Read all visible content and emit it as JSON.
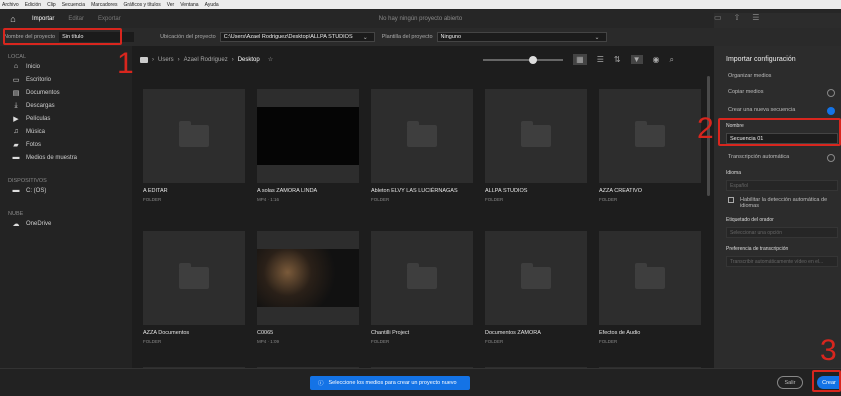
{
  "menu": [
    "Archivo",
    "Edición",
    "Clip",
    "Secuencia",
    "Marcadores",
    "Gráficos y títulos",
    "Ver",
    "Ventana",
    "Ayuda"
  ],
  "tabs": {
    "importar": "Importar",
    "editar": "Editar",
    "exportar": "Exportar"
  },
  "header_title": "No hay ningún proyecto abierto",
  "project": {
    "name_label": "Nombre del proyecto",
    "name_value": "Sin título",
    "location_label": "Ubicación del proyecto",
    "location_value": "C:\\Users\\Azael Rodriguez\\Desktop\\ALLPA STUDIOS",
    "template_label": "Plantilla del proyecto",
    "template_value": "Ninguno"
  },
  "sidebar": {
    "section1": "LOCAL",
    "local": [
      {
        "label": "Inicio",
        "icon": "home-icon"
      },
      {
        "label": "Escritorio",
        "icon": "desktop-icon"
      },
      {
        "label": "Documentos",
        "icon": "document-icon"
      },
      {
        "label": "Descargas",
        "icon": "download-icon"
      },
      {
        "label": "Películas",
        "icon": "film-icon"
      },
      {
        "label": "Música",
        "icon": "music-icon"
      },
      {
        "label": "Fotos",
        "icon": "photo-icon"
      },
      {
        "label": "Medios de muestra",
        "icon": "folder-icon"
      }
    ],
    "section2": "DISPOSITIVOS",
    "devices": [
      {
        "label": "C: (OS)",
        "icon": "drive-icon"
      }
    ],
    "section3": "NUBE",
    "cloud": [
      {
        "label": "OneDrive",
        "icon": "cloud-icon"
      }
    ]
  },
  "breadcrumb": {
    "users": "Users",
    "user": "Azael Rodriguez",
    "current": "Desktop"
  },
  "items": [
    {
      "name": "A EDITAR",
      "sub": "FOLDER",
      "type": "folder"
    },
    {
      "name": "A solas ZAMORA LINDA",
      "sub": "MP4 · 1:16",
      "type": "video-dark"
    },
    {
      "name": "Ableton ELVY LAS LUCIÉRNAGAS",
      "sub": "FOLDER",
      "type": "folder"
    },
    {
      "name": "ALLPA STUDIOS",
      "sub": "FOLDER",
      "type": "folder"
    },
    {
      "name": "AZZA CREATIVO",
      "sub": "FOLDER",
      "type": "folder"
    },
    {
      "name": "AZZA Documentos",
      "sub": "FOLDER",
      "type": "folder"
    },
    {
      "name": "C0065",
      "sub": "MP4 · 1:09",
      "type": "video-scene"
    },
    {
      "name": "Chantilli Project",
      "sub": "FOLDER",
      "type": "folder"
    },
    {
      "name": "Documentos ZAMORA",
      "sub": "FOLDER",
      "type": "folder"
    },
    {
      "name": "Efectos de Audio",
      "sub": "FOLDER",
      "type": "folder"
    }
  ],
  "right": {
    "title": "Importar configuración",
    "organize": "Organizar medios",
    "copy": "Copiar medios",
    "new_seq": "Crear una nueva secuencia",
    "name_label": "Nombre",
    "seq_value": "Secuencia 01",
    "transcription": "Transcripción automática",
    "language_label": "Idioma",
    "language_value": "Español",
    "detect_label": "Habilitar la detección automática de idiomas",
    "tag_label": "Etiquetado del orador",
    "tag_value": "Seleccionar una opción",
    "pref_label": "Preferencia de transcripción",
    "pref_value": "Transcribir automáticamente vídeo en el..."
  },
  "toast": "Seleccione los medios para crear un proyecto nuevo",
  "buttons": {
    "exit": "Salir",
    "create": "Crear"
  },
  "annotations": {
    "n1": "1",
    "n2": "2",
    "n3": "3"
  },
  "colors": {
    "accent": "#1473e6",
    "annotation": "#d8261e"
  }
}
